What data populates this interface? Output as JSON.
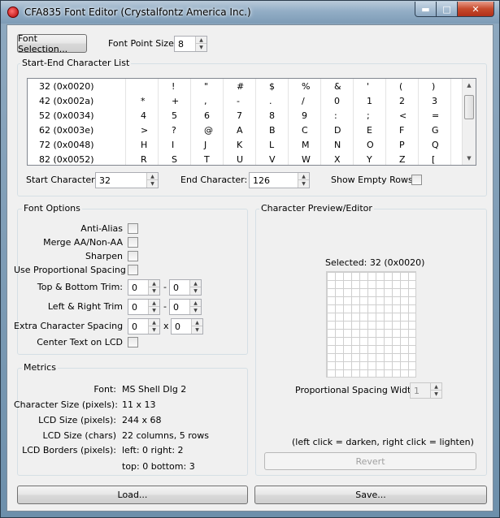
{
  "window": {
    "title": "CFA835 Font Editor (Crystalfontz America Inc.)"
  },
  "top": {
    "font_selection_label": "Font Selection...",
    "font_point_size_label": "Font Point Size:",
    "font_point_size_value": "8"
  },
  "char_list": {
    "title": "Start-End Character List",
    "rows": [
      [
        "32  (0x0020)",
        "",
        "!",
        "\"",
        "#",
        "$",
        "%",
        "&",
        "'",
        "(",
        ")"
      ],
      [
        "42  (0x002a)",
        "*",
        "+",
        ",",
        "-",
        ".",
        "/",
        "0",
        "1",
        "2",
        "3"
      ],
      [
        "52  (0x0034)",
        "4",
        "5",
        "6",
        "7",
        "8",
        "9",
        ":",
        ";",
        "<",
        "="
      ],
      [
        "62  (0x003e)",
        ">",
        "?",
        "@",
        "A",
        "B",
        "C",
        "D",
        "E",
        "F",
        "G"
      ],
      [
        "72  (0x0048)",
        "H",
        "I",
        "J",
        "K",
        "L",
        "M",
        "N",
        "O",
        "P",
        "Q"
      ],
      [
        "82  (0x0052)",
        "R",
        "S",
        "T",
        "U",
        "V",
        "W",
        "X",
        "Y",
        "Z",
        "["
      ]
    ],
    "start_label": "Start Character:",
    "start_value": "32",
    "end_label": "End Character:",
    "end_value": "126",
    "show_empty_label": "Show Empty Rows:"
  },
  "font_options": {
    "title": "Font Options",
    "anti_alias": "Anti-Alias",
    "merge": "Merge AA/Non-AA",
    "sharpen": "Sharpen",
    "proportional": "Use Proportional Spacing",
    "tb_trim": "Top & Bottom Trim:",
    "tb_trim_a": "0",
    "tb_trim_b": "0",
    "lr_trim": "Left & Right Trim",
    "lr_trim_a": "0",
    "lr_trim_b": "0",
    "extra_spacing": "Extra Character Spacing",
    "extra_a": "0",
    "extra_b": "0",
    "dash": "-",
    "times": "x",
    "center_text": "Center Text on LCD"
  },
  "metrics": {
    "title": "Metrics",
    "font_label": "Font:",
    "font_value": "MS Shell Dlg 2",
    "char_size_label": "Character Size (pixels):",
    "char_size_value": "11 x 13",
    "lcd_size_label": "LCD Size (pixels):",
    "lcd_size_value": "244 x 68",
    "lcd_chars_label": "LCD Size (chars)",
    "lcd_chars_value": "22 columns, 5 rows",
    "borders_label": "LCD Borders (pixels):",
    "borders_value": "left: 0 right: 2",
    "borders_value2": "top: 0 bottom: 3"
  },
  "preview": {
    "title": "Character Preview/Editor",
    "selected": "Selected: 32 (0x0020)",
    "prop_width_label": "Proportional Spacing Width:",
    "prop_width_value": "1",
    "hint": "(left click = darken, right click = lighten)",
    "revert_label": "Revert"
  },
  "bottom": {
    "load_label": "Load...",
    "save_label": "Save..."
  }
}
